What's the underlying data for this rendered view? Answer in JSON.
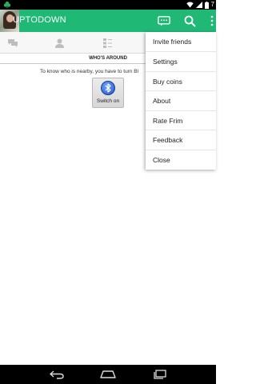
{
  "status_bar": {
    "time": "7"
  },
  "action_bar": {
    "title": "UPTODOWN"
  },
  "section": {
    "title": "WHO'S AROUND",
    "info_text": "To know who is nearby, you have to turn Bl"
  },
  "switch_button": {
    "label": "Switch on"
  },
  "menu": {
    "items": [
      "Invite friends",
      "Settings",
      "Buy coins",
      "About",
      "Rate Frim",
      "Feedback",
      "Close"
    ]
  },
  "colors": {
    "accent": "#1fb875"
  },
  "icons": {
    "action_bar": [
      "chat-bubble-icon",
      "search-icon",
      "overflow-icon"
    ],
    "tabs": [
      "chat-icon",
      "person-icon",
      "list-icon"
    ],
    "nav": [
      "back-icon",
      "home-icon",
      "recents-icon"
    ]
  }
}
